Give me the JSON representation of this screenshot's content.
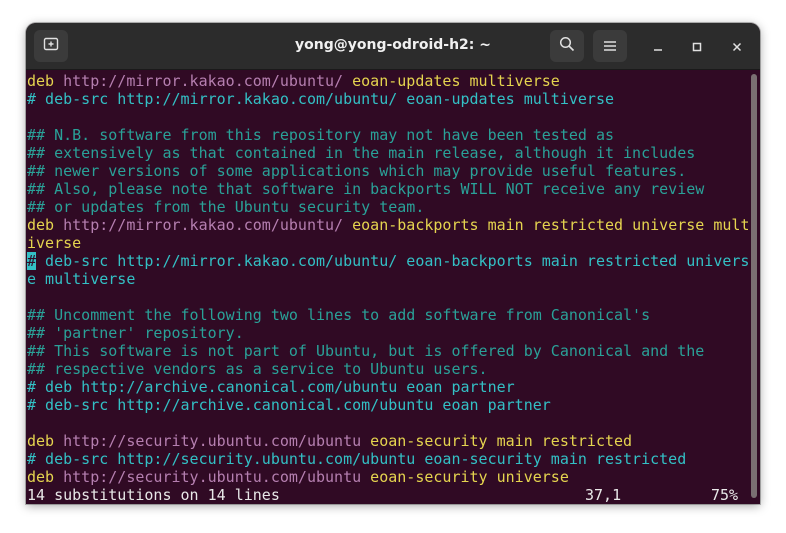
{
  "window": {
    "title": "yong@yong-odroid-h2: ~",
    "icons": {
      "new_tab": "new-tab-icon",
      "search": "search-icon",
      "menu": "hamburger-menu-icon",
      "minimize": "minimize-icon",
      "maximize": "maximize-icon",
      "close": "close-icon"
    }
  },
  "colors": {
    "terminal_bg": "#300a24",
    "keyword": "#e5d44f",
    "url": "#b57fb0",
    "comment": "#2aa198",
    "cursor": "#33c0c5"
  },
  "lines": [
    {
      "deb": "deb",
      "url": " http://mirror.kakao.com/ubuntu/",
      "rest": " eoan-updates",
      "comp": " multiverse"
    },
    {
      "text": "# deb-src http://mirror.kakao.com/ubuntu/ eoan-updates multiverse"
    },
    {
      "text": ""
    },
    {
      "text": "## N.B. software from this repository may not have been tested as"
    },
    {
      "text": "## extensively as that contained in the main release, although it includes"
    },
    {
      "text": "## newer versions of some applications which may provide useful features."
    },
    {
      "text": "## Also, please note that software in backports WILL NOT receive any review"
    },
    {
      "text": "## or updates from the Ubuntu security team."
    },
    {
      "deb": "deb",
      "url": " http://mirror.kakao.com/ubuntu/",
      "rest": " eoan-backports",
      "comp": " main restricted universe mult"
    },
    {
      "text_yel": "iverse"
    },
    {
      "cursor": "#",
      "text": " deb-src http://mirror.kakao.com/ubuntu/ eoan-backports main restricted univers"
    },
    {
      "text": "e multiverse"
    },
    {
      "text": ""
    },
    {
      "text": "## Uncomment the following two lines to add software from Canonical's"
    },
    {
      "text": "## 'partner' repository."
    },
    {
      "text": "## This software is not part of Ubuntu, but is offered by Canonical and the"
    },
    {
      "text": "## respective vendors as a service to Ubuntu users."
    },
    {
      "text": "# deb http://archive.canonical.com/ubuntu eoan partner"
    },
    {
      "text": "# deb-src http://archive.canonical.com/ubuntu eoan partner"
    },
    {
      "text": ""
    },
    {
      "deb": "deb",
      "url": " http://security.ubuntu.com/ubuntu",
      "rest": " eoan-security",
      "comp": " main restricted"
    },
    {
      "text": "# deb-src http://security.ubuntu.com/ubuntu eoan-security main restricted"
    },
    {
      "deb": "deb",
      "url": " http://security.ubuntu.com/ubuntu",
      "rest": " eoan-security",
      "comp": " universe"
    }
  ],
  "status": {
    "message": "14 substitutions on 14 lines",
    "position": "37,1",
    "percent": "75%"
  }
}
